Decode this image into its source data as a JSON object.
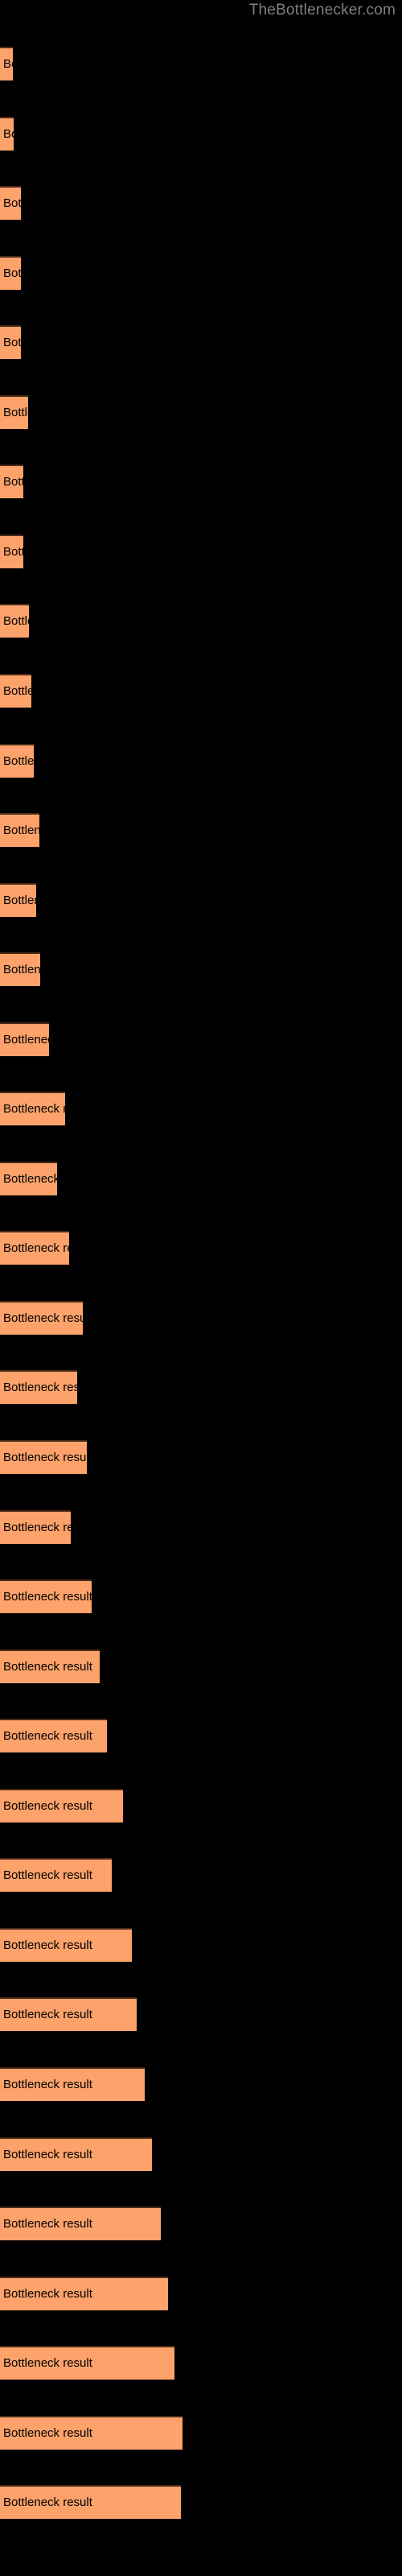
{
  "watermark": "TheBottlenecker.com",
  "colors": {
    "background": "#000000",
    "bar_fill": "#fca26a",
    "bar_top_edge": "#4a2a18",
    "bar_label_text": "#000000",
    "watermark_text": "#808080"
  },
  "chart_data": {
    "type": "bar",
    "orientation": "horizontal",
    "title": "",
    "subtitle": "",
    "xlabel": "",
    "ylabel": "",
    "grid": false,
    "legend": false,
    "axis_visible": false,
    "bar_label_text": "Bottleneck result",
    "categories": [
      "Bottleneck result",
      "Bottleneck result",
      "Bottleneck result",
      "Bottleneck result",
      "Bottleneck result",
      "Bottleneck result",
      "Bottleneck result",
      "Bottleneck result",
      "Bottleneck result",
      "Bottleneck result",
      "Bottleneck result",
      "Bottleneck result",
      "Bottleneck result",
      "Bottleneck result",
      "Bottleneck result",
      "Bottleneck result",
      "Bottleneck result",
      "Bottleneck result",
      "Bottleneck result",
      "Bottleneck result",
      "Bottleneck result",
      "Bottleneck result",
      "Bottleneck result",
      "Bottleneck result",
      "Bottleneck result",
      "Bottleneck result",
      "Bottleneck result",
      "Bottleneck result",
      "Bottleneck result",
      "Bottleneck result",
      "Bottleneck result",
      "Bottleneck result",
      "Bottleneck result",
      "Bottleneck result",
      "Bottleneck result",
      "Bottleneck result"
    ],
    "values": [
      13,
      14,
      22,
      22,
      22,
      29,
      24,
      24,
      30,
      33,
      35,
      41,
      38,
      42,
      51,
      68,
      59,
      72,
      86,
      80,
      90,
      74,
      95,
      104,
      111,
      128,
      116,
      137,
      142,
      151,
      158,
      167,
      175,
      182,
      190,
      188
    ],
    "value_unit": "px",
    "xlim": [
      0,
      240
    ],
    "note": "Bar lengths are relative widths read from the rendered pixels; no numeric axis is drawn."
  }
}
